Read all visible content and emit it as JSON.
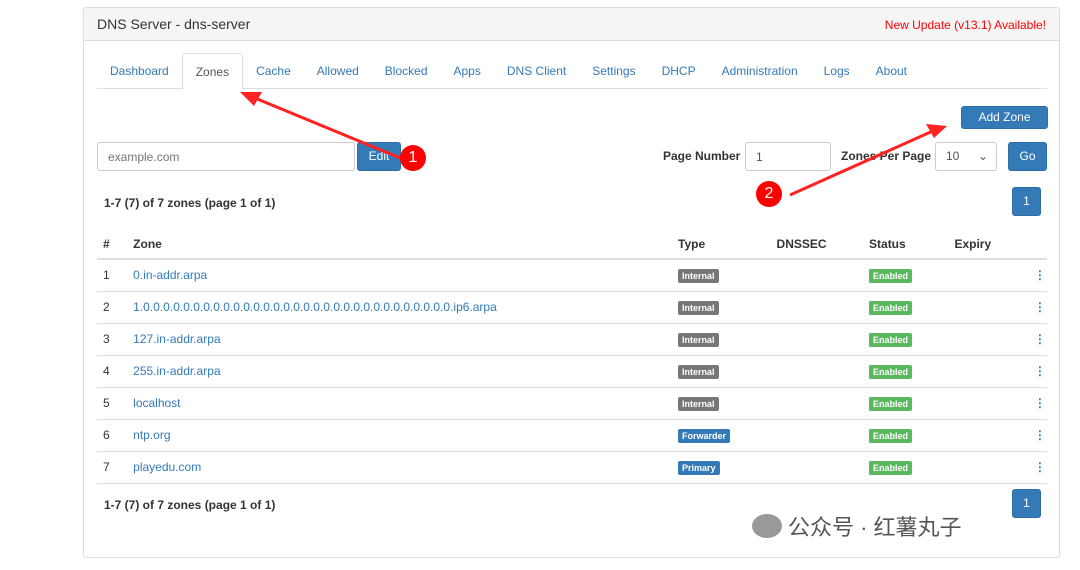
{
  "header": {
    "title": "DNS Server - dns-server",
    "update": "New Update (v13.1) Available!"
  },
  "tabs": [
    {
      "label": "Dashboard"
    },
    {
      "label": "Zones",
      "active": true
    },
    {
      "label": "Cache"
    },
    {
      "label": "Allowed"
    },
    {
      "label": "Blocked"
    },
    {
      "label": "Apps"
    },
    {
      "label": "DNS Client"
    },
    {
      "label": "Settings"
    },
    {
      "label": "DHCP"
    },
    {
      "label": "Administration"
    },
    {
      "label": "Logs"
    },
    {
      "label": "About"
    }
  ],
  "toolbar": {
    "add_zone": "Add Zone",
    "zone_placeholder": "example.com",
    "edit": "Edit",
    "page_number_label": "Page Number",
    "page_number": "1",
    "per_page_label": "Zones Per Page",
    "per_page": "10",
    "go": "Go"
  },
  "summary": "1-7 (7) of 7 zones (page 1 of 1)",
  "pagination": {
    "current": "1"
  },
  "table": {
    "headers": [
      "#",
      "Zone",
      "Type",
      "DNSSEC",
      "Status",
      "Expiry"
    ],
    "rows": [
      {
        "n": "1",
        "zone": "0.in-addr.arpa",
        "type": "Internal",
        "status": "Enabled"
      },
      {
        "n": "2",
        "zone": "1.0.0.0.0.0.0.0.0.0.0.0.0.0.0.0.0.0.0.0.0.0.0.0.0.0.0.0.0.0.0.0.ip6.arpa",
        "type": "Internal",
        "status": "Enabled"
      },
      {
        "n": "3",
        "zone": "127.in-addr.arpa",
        "type": "Internal",
        "status": "Enabled"
      },
      {
        "n": "4",
        "zone": "255.in-addr.arpa",
        "type": "Internal",
        "status": "Enabled"
      },
      {
        "n": "5",
        "zone": "localhost",
        "type": "Internal",
        "status": "Enabled"
      },
      {
        "n": "6",
        "zone": "ntp.org",
        "type": "Forwarder",
        "status": "Enabled"
      },
      {
        "n": "7",
        "zone": "playedu.com",
        "type": "Primary",
        "status": "Enabled"
      }
    ]
  },
  "type_colors": {
    "Internal": "#777777",
    "Forwarder": "#337ab7",
    "Primary": "#337ab7"
  },
  "status_color": "#5cb85c",
  "annotations": [
    "1",
    "2"
  ],
  "watermark": "公众号 · 红薯丸子"
}
